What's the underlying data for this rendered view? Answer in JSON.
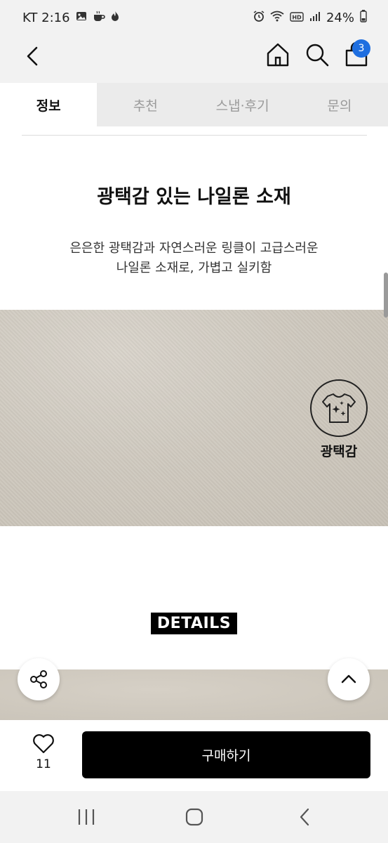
{
  "status_bar": {
    "carrier_time": "KT 2:16",
    "battery": "24%",
    "left_icons": [
      "gallery-icon",
      "coffee-icon",
      "flame-icon"
    ],
    "right_icons": [
      "alarm-icon",
      "wifi-icon",
      "hd-icon",
      "signal-icon",
      "battery-icon"
    ]
  },
  "header": {
    "bag_count": "3",
    "icons": [
      "back-arrow-icon",
      "home-icon",
      "search-icon",
      "shopping-bag-icon"
    ]
  },
  "tabs": [
    {
      "label": "정보",
      "active": true
    },
    {
      "label": "추천",
      "active": false
    },
    {
      "label": "스냅·후기",
      "active": false
    },
    {
      "label": "문의",
      "active": false
    }
  ],
  "content": {
    "headline": "광택감 있는 나일론 소재",
    "description_line1": "은은한 광택감과 자연스러운 링클이 고급스러운",
    "description_line2": "나일론 소재로, 가볍고 실키함",
    "feature_badge_label": "광택감",
    "details_label": "DETAILS"
  },
  "bottom_bar": {
    "like_count": "11",
    "buy_label": "구매하기"
  },
  "colors": {
    "accent_badge": "#1f6fe0",
    "buy_button": "#000000",
    "fabric": "#cfc9bf"
  }
}
